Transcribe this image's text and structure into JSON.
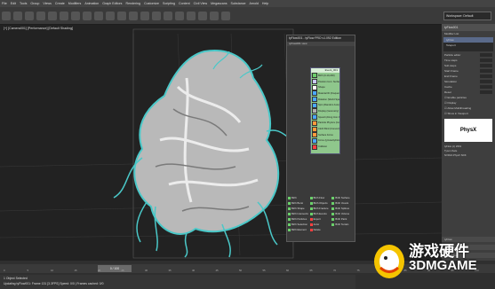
{
  "menu": {
    "items": [
      "File",
      "Edit",
      "Tools",
      "Group",
      "Views",
      "Create",
      "Modifiers",
      "Animation",
      "Graph Editors",
      "Rendering",
      "Customize",
      "Scripting",
      "Content",
      "Civil View",
      "Megascans",
      "Substance",
      "Arnold",
      "Help"
    ]
  },
  "toolbar": {
    "selection_set": "",
    "workspace_label": "Workspace: Default"
  },
  "viewport": {
    "label": "[+] [Camera001] [Performance] [Default Shading]"
  },
  "dialog": {
    "title": "tyFlow001 - tyFlow PRO v1.092 Edition",
    "tab": "tyFlow001  view",
    "panel_header": "Event_001",
    "panel_items": [
      {
        "label": "Birth (0-10,200)",
        "color": "#6ad06a"
      },
      {
        "label": "Position Icon: Surface",
        "color": "#c9c9ff"
      },
      {
        "label": "Shape",
        "color": "#ffffff"
      },
      {
        "label": "Material ID (Frequency)",
        "color": "#4aa8ff"
      },
      {
        "label": "Rotation (World Space)",
        "color": "#4aa8ff"
      },
      {
        "label": "Spin (Random Axis)",
        "color": "#4aa8ff"
      },
      {
        "label": "Display (Geometry)",
        "color": "#b0b0b0"
      },
      {
        "label": "Speed (Along Icon Arrow)",
        "color": "#4aa8ff"
      },
      {
        "label": "Particle Physics (Collide: Bind)",
        "color": "#ff9a3c"
      },
      {
        "label": "Cloth Bind (Convert)",
        "color": "#ff9a3c"
      },
      {
        "label": "Surface Force",
        "color": "#ff9a3c"
      },
      {
        "label": "Force (tyGravityFlow)",
        "color": "#4aa8ff"
      },
      {
        "label": "Collision",
        "color": "#ff4040"
      }
    ],
    "operators": [
      {
        "label": "Birth",
        "color": "#6ad06a"
      },
      {
        "label": "Birth Flow",
        "color": "#6ad06a"
      },
      {
        "label": "Birth Surface",
        "color": "#6ad06a"
      },
      {
        "label": "Birth Burst",
        "color": "#6ad06a"
      },
      {
        "label": "Birth Objects",
        "color": "#6ad06a"
      },
      {
        "label": "Birth Voxels",
        "color": "#6ad06a"
      },
      {
        "label": "Birth Shape",
        "color": "#6ad06a"
      },
      {
        "label": "Birth Fracture",
        "color": "#6ad06a"
      },
      {
        "label": "Birth Splines",
        "color": "#6ad06a"
      },
      {
        "label": "Birth Intersections",
        "color": "#6ad06a"
      },
      {
        "label": "Birth Events",
        "color": "#6ad06a"
      },
      {
        "label": "Birth Volume",
        "color": "#6ad06a"
      },
      {
        "label": "Birth Particles",
        "color": "#6ad06a"
      },
      {
        "label": "Export",
        "color": "#ff4040"
      },
      {
        "label": "Birth Paint",
        "color": "#6ad06a"
      },
      {
        "label": "Birth Selection",
        "color": "#6ad06a"
      },
      {
        "label": "Actor",
        "color": "#ff4040"
      },
      {
        "label": "Birth Terrain",
        "color": "#6ad06a"
      },
      {
        "label": "Birth Element",
        "color": "#6ad06a"
      },
      {
        "label": "Delete",
        "color": "#ff4040"
      }
    ]
  },
  "right_panel": {
    "header": "tyFlow001",
    "modifier_list": "Modifier List",
    "stack": [
      "tyFlow",
      "Teleport"
    ],
    "params": [
      "Particle editor",
      "Time steps",
      "Sub steps",
      "Start Frame",
      "End Frame",
      "Simulation",
      "Cache",
      "Reset"
    ],
    "checks": [
      "Enable particles",
      "Display",
      "Allow Multithreading",
      "Show in Viewport"
    ],
    "physx_label": "PhysX",
    "about_lines": [
      "tyFlow (c) 2019",
      "Tyson Ibele",
      "NVIDIA PhysX SDK"
    ],
    "bottom": [
      "tyFlow",
      "Interface",
      "Debugging"
    ]
  },
  "timeline": {
    "frame_label": "0 / 100",
    "ticks": [
      "0",
      "5",
      "10",
      "15",
      "20",
      "25",
      "30",
      "35",
      "40",
      "45",
      "50",
      "55",
      "60",
      "65",
      "70",
      "75",
      "80",
      "85",
      "90",
      "95",
      "100"
    ]
  },
  "status": {
    "objects": "1 Object Selected",
    "message": "Updating tyFlow001: Frame 131 [3.3FPS] Speed: 0/0 | Frames cached: 0/0"
  },
  "watermark": {
    "line1": "游戏硬件",
    "line2": "3DMGAME"
  },
  "colors": {
    "background": "#1e1e1e",
    "cloth_cyan": "#4ac8c8",
    "accent": "#ff7b00"
  }
}
